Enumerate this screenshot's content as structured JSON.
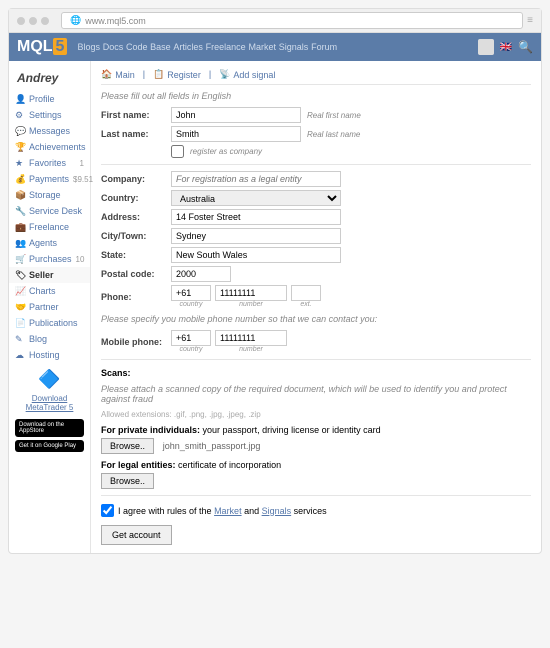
{
  "url": "www.mql5.com",
  "logo_text": "MQL",
  "logo_suffix": "5",
  "nav": [
    "Blogs",
    "Docs",
    "Code Base",
    "Articles",
    "Freelance",
    "Market",
    "Signals",
    "Forum"
  ],
  "username": "Andrey",
  "sidebar": [
    {
      "icon": "👤",
      "label": "Profile"
    },
    {
      "icon": "⚙",
      "label": "Settings"
    },
    {
      "icon": "💬",
      "label": "Messages"
    },
    {
      "icon": "🏆",
      "label": "Achievements"
    },
    {
      "icon": "★",
      "label": "Favorites",
      "badge": "1"
    },
    {
      "icon": "💰",
      "label": "Payments",
      "badge": "$9.51"
    },
    {
      "icon": "📦",
      "label": "Storage"
    },
    {
      "icon": "🔧",
      "label": "Service Desk"
    },
    {
      "icon": "💼",
      "label": "Freelance"
    },
    {
      "icon": "👥",
      "label": "Agents"
    },
    {
      "icon": "🛒",
      "label": "Purchases",
      "badge": "10"
    },
    {
      "icon": "🏷",
      "label": "Seller",
      "active": true
    },
    {
      "icon": "📈",
      "label": "Charts"
    },
    {
      "icon": "🤝",
      "label": "Partner"
    },
    {
      "icon": "📄",
      "label": "Publications"
    },
    {
      "icon": "✎",
      "label": "Blog"
    },
    {
      "icon": "☁",
      "label": "Hosting"
    }
  ],
  "download_label": "Download MetaTrader 5",
  "appstore": "Download on the AppStore",
  "gplay": "Get it on Google Play",
  "tabs": {
    "main": "Main",
    "register": "Register",
    "addsignal": "Add signal"
  },
  "form": {
    "note": "Please fill out all fields in English",
    "first_name_lbl": "First name:",
    "first_name": "John",
    "first_name_hint": "Real first name",
    "last_name_lbl": "Last name:",
    "last_name": "Smith",
    "last_name_hint": "Real last name",
    "register_company": "register as company",
    "company_lbl": "Company:",
    "company_ph": "For registration as a legal entity",
    "country_lbl": "Country:",
    "country": "Australia",
    "address_lbl": "Address:",
    "address": "14 Foster Street",
    "city_lbl": "City/Town:",
    "city": "Sydney",
    "state_lbl": "State:",
    "state": "New South Wales",
    "postal_lbl": "Postal code:",
    "postal": "2000",
    "phone_lbl": "Phone:",
    "phone_country": "+61",
    "phone_num": "11111111",
    "country_sub": "country",
    "number_sub": "number",
    "ext_sub": "ext.",
    "mobile_note": "Please specify you mobile phone number so that we can contact you:",
    "mobile_lbl": "Mobile phone:",
    "mobile_country": "+61",
    "mobile_num": "11111111",
    "scans_title": "Scans:",
    "scans_note": "Please attach a scanned copy of the required document, which will be used to identify you and protect against fraud",
    "allowed": "Allowed extensions: .gif, .png, .jpg, .jpeg, .zip",
    "private_lbl": "For private individuals:",
    "private_desc": "your passport, driving license or identity card",
    "browse": "Browse..",
    "uploaded_file": "john_smith_passport.jpg",
    "legal_lbl": "For legal entities:",
    "legal_desc": "certificate of incorporation",
    "agree_pre": "I agree with rules of the ",
    "agree_market": "Market",
    "agree_and": " and ",
    "agree_signals": "Signals",
    "agree_post": " services",
    "submit": "Get account"
  }
}
